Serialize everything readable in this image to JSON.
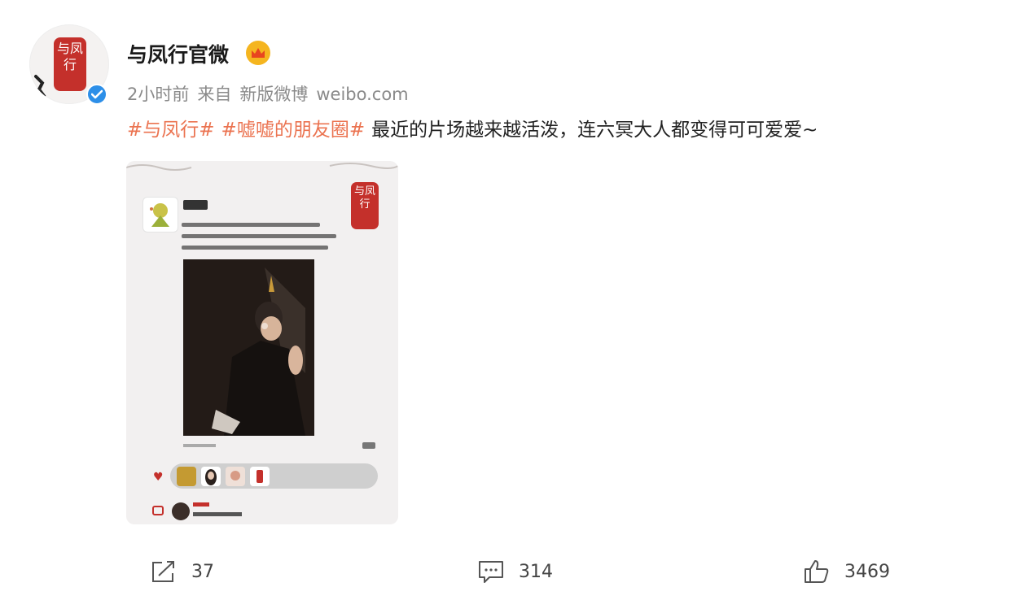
{
  "user": {
    "name": "与凤行官微",
    "avatar_text": "与凤行",
    "badge_icon": "member-crown-icon",
    "verified_icon": "verified-check-icon",
    "verified_color": "#2d8fe8"
  },
  "meta": {
    "time": "2小时前",
    "source_prefix": "来自",
    "source_client": "新版微博",
    "source_domain": "weibo.com"
  },
  "post": {
    "tag1": "#与凤行#",
    "tag2": "#嘘嘘的朋友圈#",
    "text": "最近的片场越来越活泼，连六冥大人都变得可可爱爱~",
    "tag_color": "#eb7350"
  },
  "image_card": {
    "seal_text": "与凤行"
  },
  "actions": {
    "repost_count": "37",
    "comment_count": "314",
    "like_count": "3469"
  }
}
